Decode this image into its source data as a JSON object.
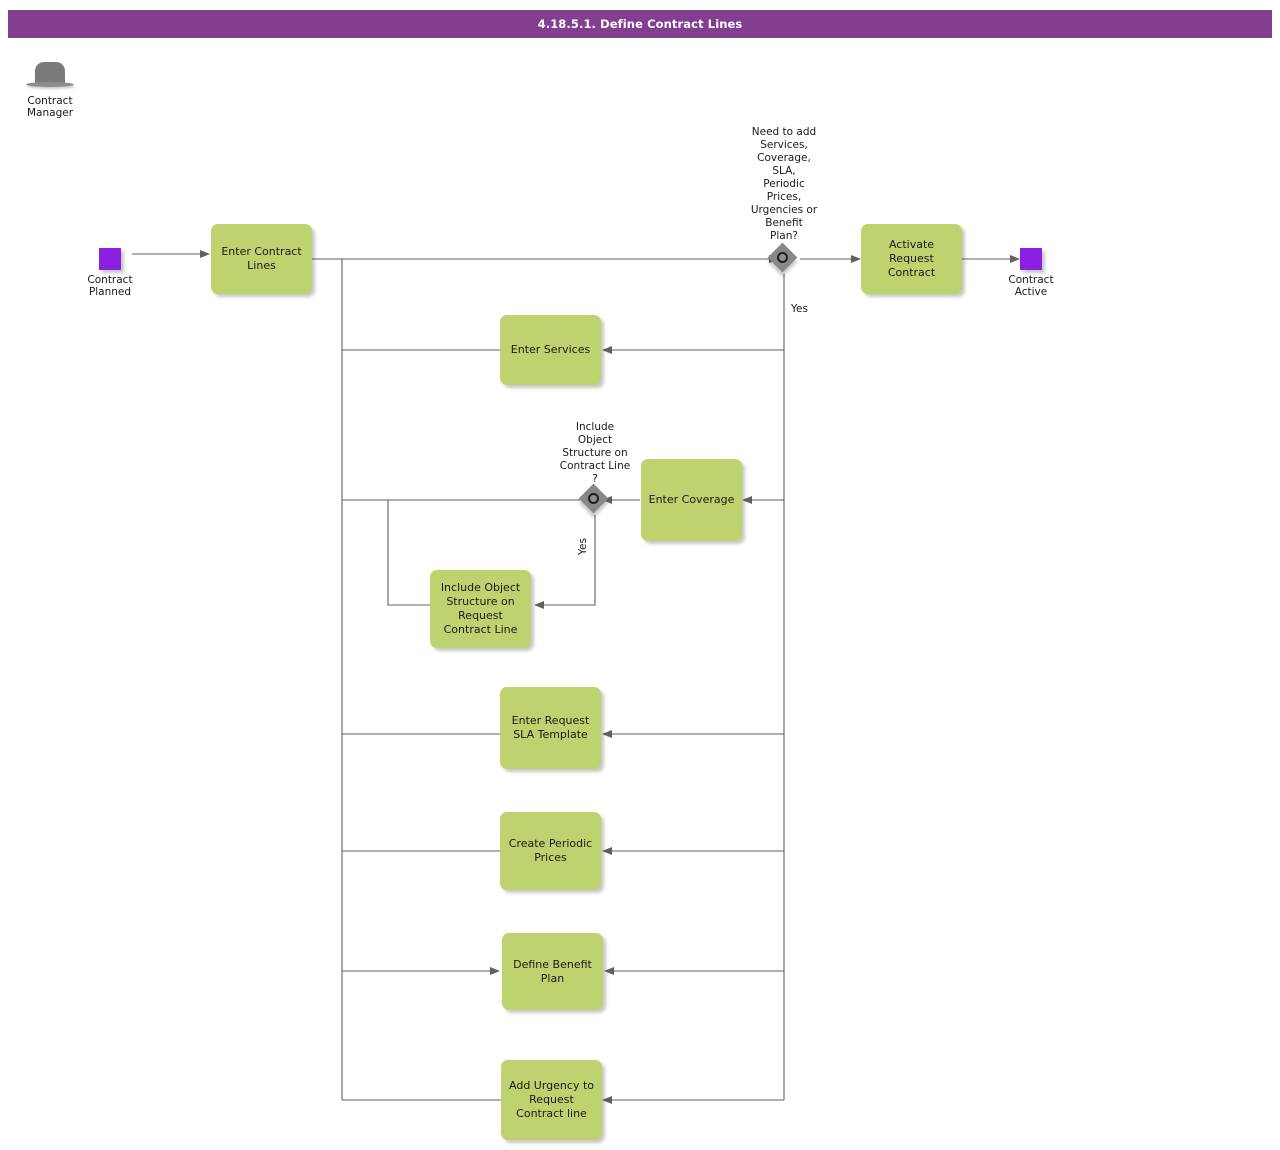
{
  "header": {
    "title": "4.18.5.1. Define Contract Lines",
    "bar_color": "#833f8f",
    "text_color": "#ffffff"
  },
  "palette": {
    "task_fill": "#bed36f",
    "event_fill": "#8b20e0",
    "gateway_fill": "#888888",
    "connector": "#5f6063"
  },
  "lane": {
    "role_icon": "bowler-hat-icon",
    "role_label": "Contract\nManager",
    "role_line1": "Contract",
    "role_line2": "Manager"
  },
  "events": [
    {
      "id": "start",
      "type": "start-event",
      "label_line1": "Contract",
      "label_line2": "Planned",
      "label": "Contract Planned"
    },
    {
      "id": "end",
      "type": "end-event",
      "label_line1": "Contract",
      "label_line2": "Active",
      "label": "Contract Active"
    }
  ],
  "gateways": [
    {
      "id": "gw-need-to-add",
      "type": "inclusive-gateway",
      "label": "Need to add Services, Coverage, SLA, Periodic Prices, Urgencies or Benefit Plan?",
      "lines": [
        "Need to add",
        "Services,",
        "Coverage,",
        "SLA,",
        "Periodic",
        "Prices,",
        "Urgencies or",
        "Benefit",
        "Plan?"
      ],
      "branch_label": "Yes"
    },
    {
      "id": "gw-include-object-structure",
      "type": "inclusive-gateway",
      "label": "Include Object Structure on Contract Line ?",
      "lines": [
        "Include",
        "Object",
        "Structure on",
        "Contract Line",
        "?"
      ],
      "branch_label": "Yes"
    }
  ],
  "tasks": [
    {
      "id": "enter-contract-lines",
      "label": "Enter Contract Lines"
    },
    {
      "id": "activate-request-contract",
      "label": "Activate Request Contract"
    },
    {
      "id": "enter-services",
      "label": "Enter Services"
    },
    {
      "id": "enter-coverage",
      "label": "Enter Coverage"
    },
    {
      "id": "include-object-structure-on-request-contract-line",
      "label": "Include Object Structure on Request Contract Line"
    },
    {
      "id": "enter-request-sla-template",
      "label": "Enter Request SLA Template"
    },
    {
      "id": "create-periodic-prices",
      "label": "Create Periodic Prices"
    },
    {
      "id": "define-benefit-plan",
      "label": "Define Benefit Plan"
    },
    {
      "id": "add-urgency-to-request-contract-line",
      "label": "Add Urgency to Request Contract line"
    }
  ]
}
